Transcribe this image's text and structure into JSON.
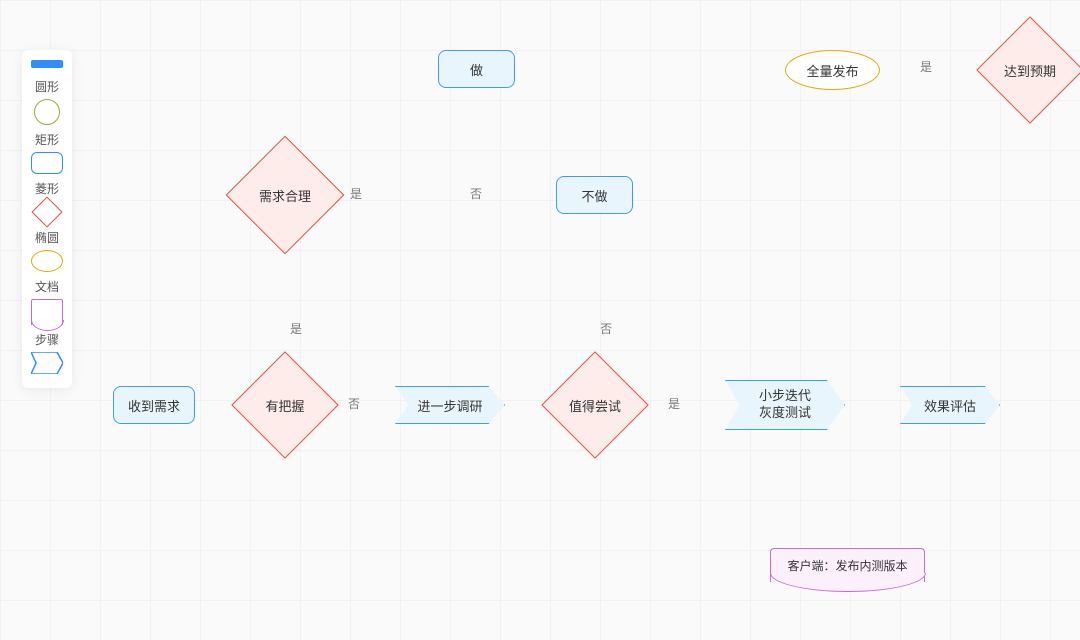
{
  "palette": {
    "circle": "圆形",
    "rect": "矩形",
    "diamond": "菱形",
    "ellipse": "椭圆",
    "doc": "文档",
    "step": "步骤"
  },
  "nodes": {
    "receive_req": "收到需求",
    "confident": "有把握",
    "req_reasonable": "需求合理",
    "do": "做",
    "not_do": "不做",
    "further_research": "进一步调研",
    "worth_trying": "值得尝试",
    "iterate_gray": "小步迭代\n灰度测试",
    "effect_eval": "效果评估",
    "meet_expect": "达到预期",
    "full_release": "全量发布",
    "client_beta": "客户端：发布内测版本"
  },
  "labels": {
    "yes": "是",
    "no": "否"
  }
}
